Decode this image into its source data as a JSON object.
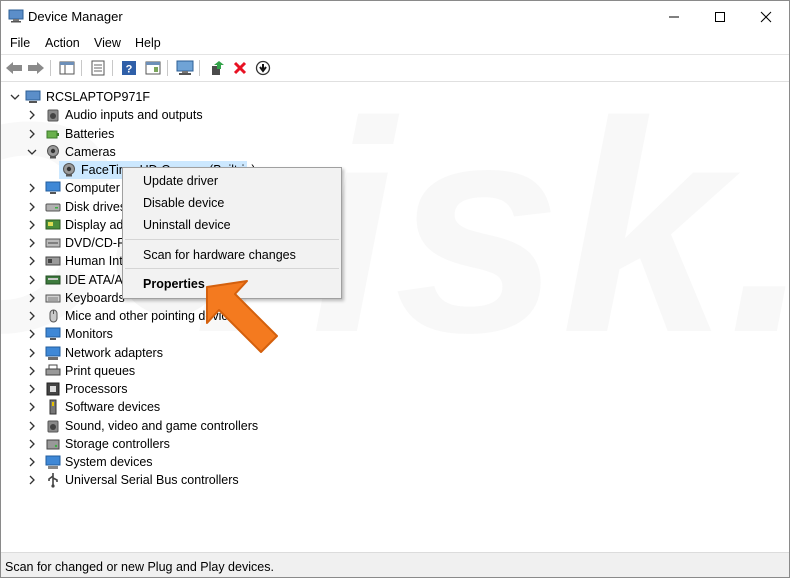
{
  "window": {
    "title": "Device Manager"
  },
  "menu": [
    "File",
    "Action",
    "View",
    "Help"
  ],
  "tree": {
    "root": "RCSLAPTOP971F",
    "items": [
      {
        "label": "Audio inputs and outputs",
        "icon": "speaker-icon",
        "expanded": false
      },
      {
        "label": "Batteries",
        "icon": "battery-icon",
        "expanded": false
      },
      {
        "label": "Cameras",
        "icon": "camera-icon",
        "expanded": true
      },
      {
        "label": "FaceTime HD Camera (Built-in)",
        "icon": "camera-icon",
        "child": true,
        "selected": true
      },
      {
        "label": "Computer",
        "icon": "monitor-icon",
        "expanded": false
      },
      {
        "label": "Disk drives",
        "icon": "disk-icon",
        "expanded": false
      },
      {
        "label": "Display adapters",
        "icon": "display-adapter-icon",
        "expanded": false
      },
      {
        "label": "DVD/CD-ROM drives",
        "icon": "dvd-icon",
        "expanded": false
      },
      {
        "label": "Human Interface Devices",
        "icon": "hid-icon",
        "expanded": false
      },
      {
        "label": "IDE ATA/ATAPI controllers",
        "icon": "ide-icon",
        "expanded": false
      },
      {
        "label": "Keyboards",
        "icon": "keyboard-icon",
        "expanded": false
      },
      {
        "label": "Mice and other pointing devices",
        "icon": "mouse-icon",
        "expanded": false
      },
      {
        "label": "Monitors",
        "icon": "monitor-icon",
        "expanded": false
      },
      {
        "label": "Network adapters",
        "icon": "network-icon",
        "expanded": false
      },
      {
        "label": "Print queues",
        "icon": "printer-icon",
        "expanded": false
      },
      {
        "label": "Processors",
        "icon": "processor-icon",
        "expanded": false
      },
      {
        "label": "Software devices",
        "icon": "software-device-icon",
        "expanded": false
      },
      {
        "label": "Sound, video and game controllers",
        "icon": "speaker-icon",
        "expanded": false
      },
      {
        "label": "Storage controllers",
        "icon": "storage-icon",
        "expanded": false
      },
      {
        "label": "System devices",
        "icon": "system-icon",
        "expanded": false
      },
      {
        "label": "Universal Serial Bus controllers",
        "icon": "usb-icon",
        "expanded": false
      }
    ]
  },
  "context_menu": {
    "update": "Update driver",
    "disable": "Disable device",
    "uninstall": "Uninstall device",
    "scan": "Scan for hardware changes",
    "properties": "Properties"
  },
  "status": "Scan for changed or new Plug and Play devices.",
  "watermark": "PC risk.com",
  "colors": {
    "accent_arrow": "#f47a1f",
    "selection": "#cce8ff",
    "delete_red": "#e81123"
  }
}
